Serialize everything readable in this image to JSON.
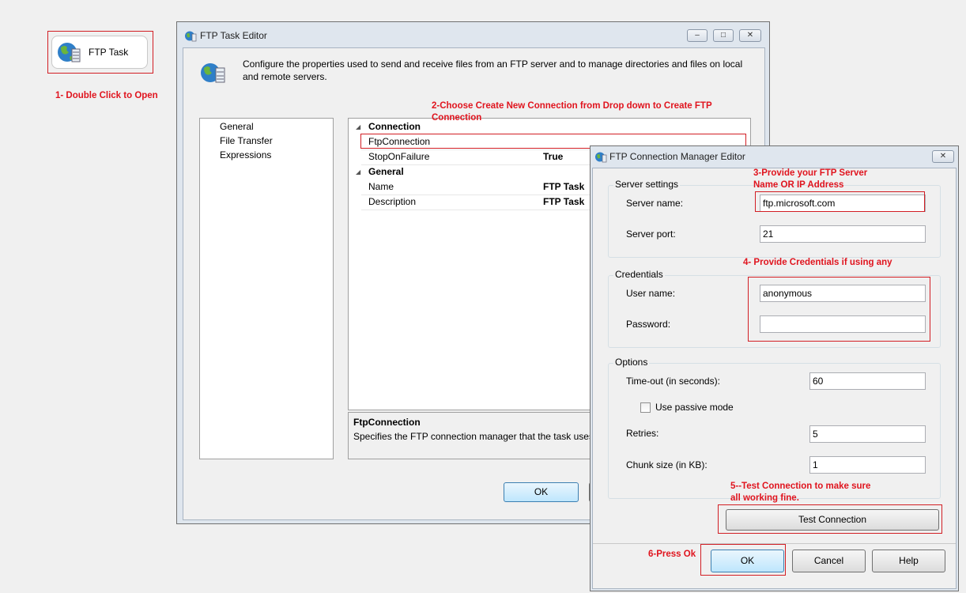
{
  "task_node": {
    "label": "FTP Task"
  },
  "annotations": {
    "step1": "1- Double Click to Open",
    "step2_line1": "2-Choose Create New Connection from Drop down to Create FTP",
    "step2_line2": "Connection",
    "step3_line1": "3-Provide your FTP Server",
    "step3_line2": "Name OR IP Address",
    "step4": "4- Provide Credentials if using any",
    "step5_line1": "5--Test Connection to make sure",
    "step5_line2": "all working fine.",
    "step6": "6-Press Ok"
  },
  "ftp_task_editor": {
    "title": "FTP Task Editor",
    "description_line1": "Configure the properties used to send and receive files from an FTP server and to manage directories and files on local",
    "description_line2": "and remote servers.",
    "nav_items": [
      "General",
      "File Transfer",
      "Expressions"
    ],
    "properties": {
      "connection_section": "Connection",
      "ftp_connection_label": "FtpConnection",
      "ftp_connection_value": "",
      "stop_on_failure_label": "StopOnFailure",
      "stop_on_failure_value": "True",
      "general_section": "General",
      "name_label": "Name",
      "name_value": "FTP Task",
      "description_label": "Description",
      "description_value": "FTP Task"
    },
    "help_box": {
      "title": "FtpConnection",
      "text": "Specifies the FTP connection manager that the task uses."
    },
    "ok_label": "OK"
  },
  "connection_manager_editor": {
    "title": "FTP Connection Manager Editor",
    "server_settings": {
      "legend": "Server settings",
      "server_name_label": "Server name:",
      "server_name_value": "ftp.microsoft.com",
      "server_port_label": "Server port:",
      "server_port_value": "21"
    },
    "credentials": {
      "legend": "Credentials",
      "user_name_label": "User name:",
      "user_name_value": "anonymous",
      "password_label": "Password:",
      "password_value": ""
    },
    "options": {
      "legend": "Options",
      "timeout_label": "Time-out (in seconds):",
      "timeout_value": "60",
      "passive_label": "Use passive mode",
      "passive_checked": false,
      "retries_label": "Retries:",
      "retries_value": "5",
      "chunk_label": "Chunk size (in KB):",
      "chunk_value": "1"
    },
    "test_connection_label": "Test Connection",
    "ok_label": "OK",
    "cancel_label": "Cancel",
    "help_label": "Help"
  },
  "icons": [
    "globe-database-icon",
    "minimize-icon",
    "restore-icon",
    "close-icon",
    "expand-triangle-icon"
  ]
}
